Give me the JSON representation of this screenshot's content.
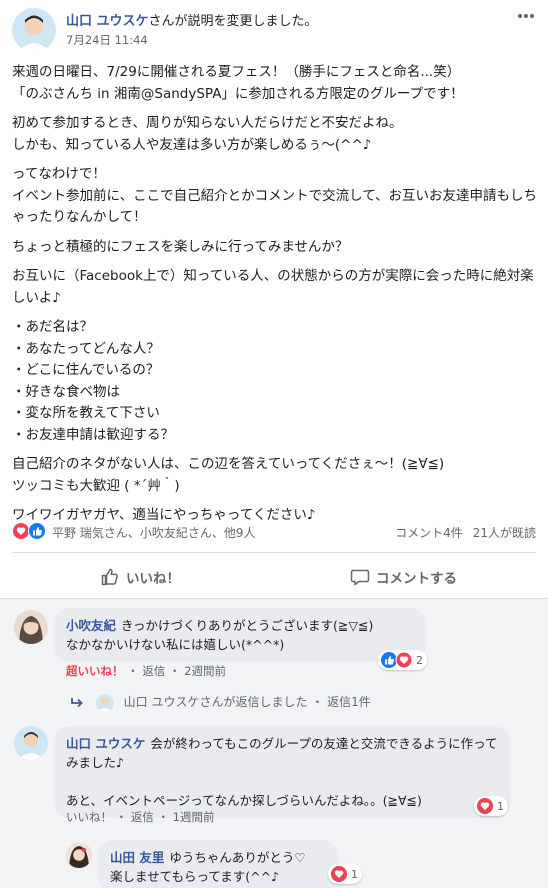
{
  "post": {
    "author": "山口 ユウスケ",
    "action_text": "さんが説明を変更しました。",
    "time": "7月24日 11:44",
    "paragraphs": [
      "来週の日曜日、7/29に開催される夏フェス！（勝手にフェスと命名...笑）\n「のぶさんち in 湘南@SandySPA」に参加される方限定のグループです！",
      "初めて参加するとき、周りが知らない人だらけだと不安だよね。\nしかも、知っている人や友達は多い方が楽しめるぅ～(^^♪",
      "ってなわけで！\nイベント参加前に、ここで自己紹介とかコメントで交流して、お互いお友達申請もしちゃったりなんかして！",
      "ちょっと積極的にフェスを楽しみに行ってみませんか？",
      "お互いに（Facebook上で）知っている人、の状態からの方が実際に会った時に絶対楽しいよ♪",
      "・あだ名は？\n・あなたってどんな人？\n・どこに住んでいるの？\n・好きな食べ物は\n・変な所を教えて下さい\n・お友達申請は歓迎する？",
      "自己紹介のネタがない人は、この辺を答えていってくださぇ～！(≧∀≦)\nツッコミも大歓迎 ( *´艸｀)",
      "ワイワイガヤガヤ、適当にやっちゃってください♪"
    ]
  },
  "reactions": {
    "names": "平野 瑞気さん、小吹友紀さん、他9人",
    "comments": "コメント4件",
    "seen": "21人が既読"
  },
  "actions": {
    "like": "いいね！",
    "comment": "コメントする"
  },
  "comments": [
    {
      "name": "小吹友紀",
      "text": "きっかけづくりありがとうございます(≧▽≦)\nなかなかいけない私には嬉しい(*^^*)",
      "reaction_label": "超いいね！",
      "reply": "返信",
      "age": "2週間前",
      "reaction_count": "2"
    },
    {
      "name": "山口 ユウスケ",
      "text": "会が終わってもこのグループの友達と交流できるように作ってみました♪\n\nあと、イベントページってなんか探しづらいんだよね。。(≧∀≦)",
      "reaction_label": "いいね！",
      "reply": "返信",
      "age": "1週間前",
      "reaction_count": "1"
    },
    {
      "name": "山田 友里",
      "text": "ゆうちゃんありがとう♡\n楽しませてもらってます(^^♪",
      "reaction_count": "1"
    }
  ],
  "reply_summary": {
    "author": "山口 ユウスケ",
    "text": "さんが返信しました",
    "count": "返信1件"
  },
  "meta_separator": "・",
  "colors": {
    "link": "#385898",
    "love": "#f33e58",
    "like": "#1877f2"
  },
  "icons": [
    "more-icon",
    "like-icon",
    "love-icon",
    "comment-icon",
    "reply-arrow-icon"
  ]
}
